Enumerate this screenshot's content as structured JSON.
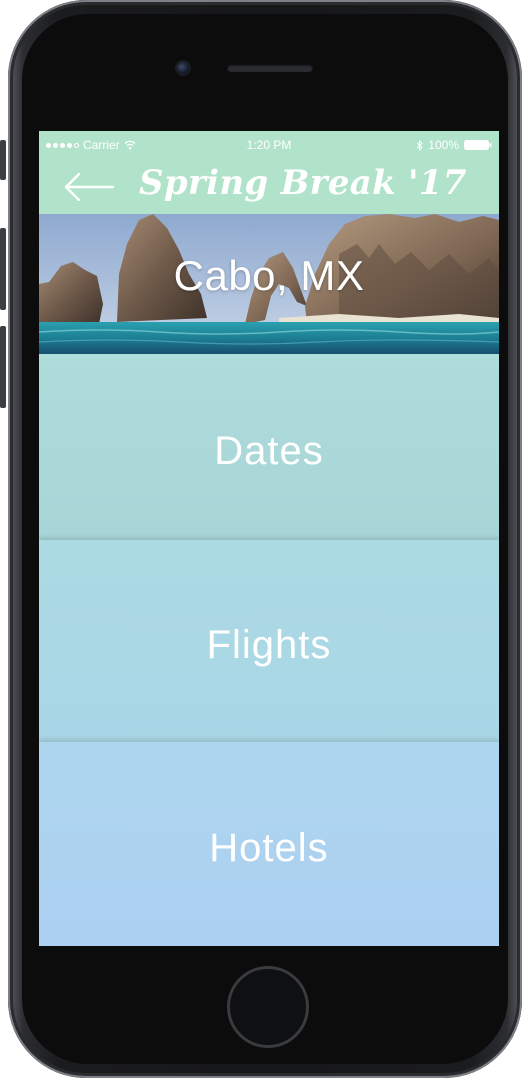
{
  "status_bar": {
    "carrier": "Carrier",
    "time": "1:20 PM",
    "battery": "100%"
  },
  "nav": {
    "title": "Spring Break '17",
    "back_icon": "arrow-left-icon"
  },
  "hero": {
    "destination": "Cabo, MX"
  },
  "menu": {
    "items": [
      {
        "label": "Dates"
      },
      {
        "label": "Flights"
      },
      {
        "label": "Hotels"
      }
    ]
  },
  "colors": {
    "header": "#b1e3cb",
    "dates": "#aedcdb",
    "flights": "#acdae2",
    "hotels": "#add5ee"
  }
}
